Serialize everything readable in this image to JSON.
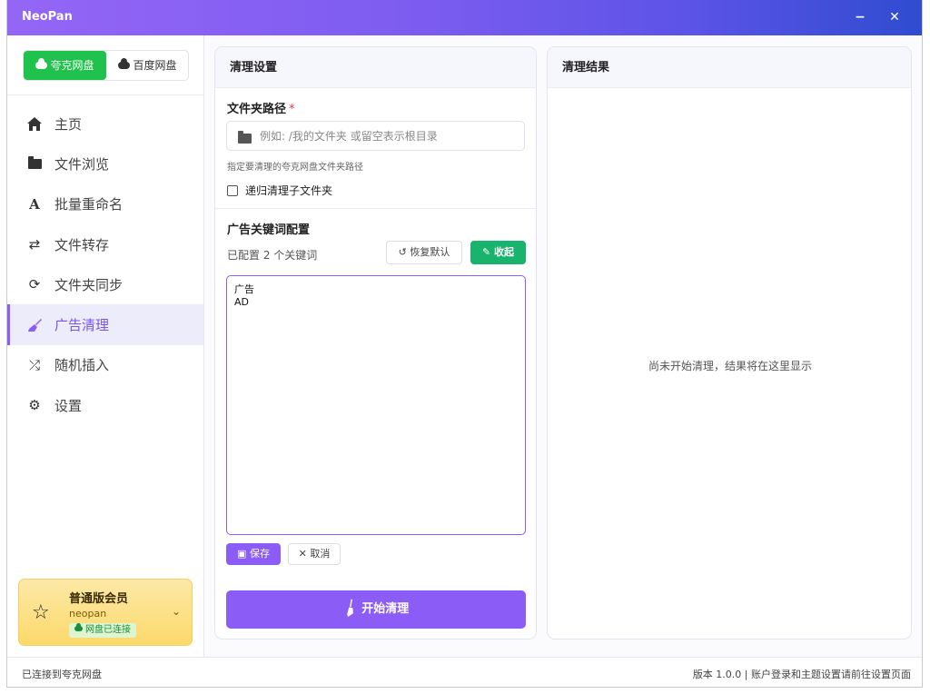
{
  "window": {
    "title": "NeoPan",
    "minimize_glyph": "−",
    "close_glyph": "✕",
    "accent": "#8b5cf6"
  },
  "drive_switch": {
    "items": [
      {
        "label": "夸克网盘",
        "active": true,
        "color": "#1fc24c"
      },
      {
        "label": "百度网盘",
        "active": false
      }
    ]
  },
  "sidebar": {
    "items": [
      {
        "label": "主页",
        "icon": "home-icon"
      },
      {
        "label": "文件浏览",
        "icon": "folder-icon"
      },
      {
        "label": "批量重命名",
        "icon": "font-icon"
      },
      {
        "label": "文件转存",
        "icon": "transfer-icon"
      },
      {
        "label": "文件夹同步",
        "icon": "sync-icon"
      },
      {
        "label": "广告清理",
        "icon": "broom-icon",
        "active": true
      },
      {
        "label": "随机插入",
        "icon": "shuffle-icon"
      },
      {
        "label": "设置",
        "icon": "gear-icon"
      }
    ]
  },
  "member": {
    "title": "普通版会员",
    "username": "neopan",
    "badge": "网盘已连接"
  },
  "settings_panel": {
    "title": "清理设置",
    "path_label": "文件夹路径",
    "required_mark": "*",
    "path_value": "",
    "path_placeholder": "例如: /我的文件夹 或留空表示根目录",
    "path_hint": "指定要清理的夸克网盘文件夹路径",
    "recursive_label": "递归清理子文件夹",
    "recursive_checked": false,
    "keywords_title": "广告关键词配置",
    "keywords_count": "已配置 2 个关键词",
    "restore_label": "恢复默认",
    "collapse_label": "收起",
    "keywords_text": "广告\nAD",
    "save_label": "保存",
    "cancel_label": "取消",
    "start_label": "开始清理"
  },
  "results_panel": {
    "title": "清理结果",
    "empty_message": "尚未开始清理，结果将在这里显示"
  },
  "statusbar": {
    "left": "已连接到夸克网盘",
    "right": "版本 1.0.0 | 账户登录和主题设置请前往设置页面"
  }
}
